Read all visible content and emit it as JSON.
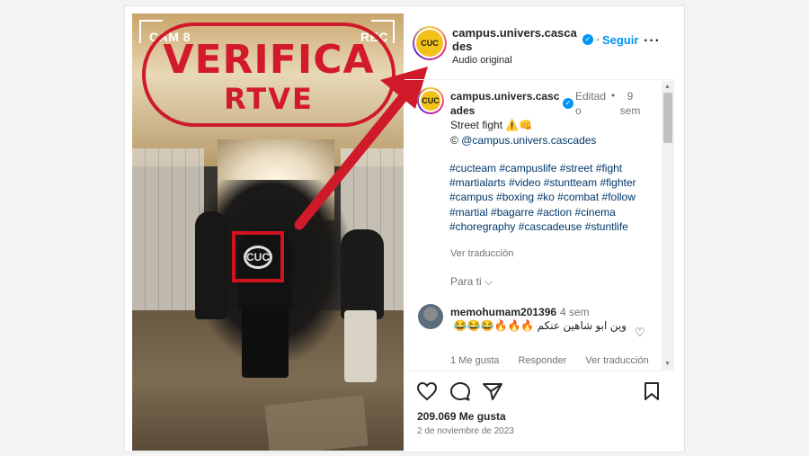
{
  "overlay": {
    "cam_label": "CAM 8",
    "rec_label": "REC",
    "verifica_line1": "VERIFICA",
    "verifica_line2": "RTVE",
    "logo_text": "CUC",
    "accent_red": "#cf1a2a"
  },
  "post_header": {
    "username": "campus.univers.cascades",
    "follow_label": "Seguir",
    "audio": "Audio original",
    "more_icon": "more-horizontal-icon"
  },
  "caption": {
    "username": "campus.univers.cascades",
    "edited": "Editado",
    "dot": "•",
    "time": "9 sem",
    "text": "Street fight ⚠️👊",
    "credit_symbol": "©",
    "credit_handle": "@campus.univers.cascades",
    "hashtags": [
      "#cucteam",
      "#campuslife",
      "#street",
      "#fight",
      "#martialarts",
      "#video",
      "#stuntteam",
      "#fighter",
      "#campus",
      "#boxing",
      "#ko",
      "#combat",
      "#follow",
      "#martial",
      "#bagarre",
      "#action",
      "#cinema",
      "#choregraphy",
      "#cascadeuse",
      "#stuntlife"
    ],
    "see_translation": "Ver traducción",
    "for_you": "Para ti"
  },
  "comment": {
    "username": "memohumam201396",
    "time": "4 sem",
    "text": "وين ابو شاهين عنكم 🔥🔥🔥😂😂😂",
    "likes": "1 Me gusta",
    "reply": "Responder",
    "see_translation": "Ver traducción"
  },
  "footer": {
    "likes": "209.069 Me gusta",
    "date": "2 de noviembre de 2023"
  },
  "colors": {
    "link": "#00376b",
    "follow_blue": "#0095f6",
    "muted": "#737373"
  }
}
